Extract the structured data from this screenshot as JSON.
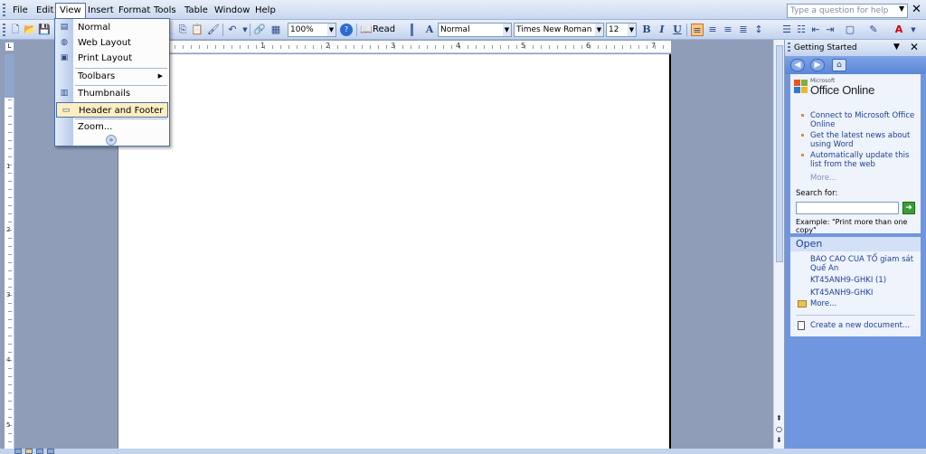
{
  "menu": {
    "items": [
      "File",
      "Edit",
      "View",
      "Insert",
      "Format",
      "Tools",
      "Table",
      "Window",
      "Help"
    ],
    "active": "View"
  },
  "help": {
    "placeholder": "Type a question for help"
  },
  "toolbar": {
    "zoom": "100%",
    "read_label": "Read",
    "style": "Normal",
    "font": "Times New Roman",
    "size": "12",
    "bold": "B",
    "italic": "I",
    "underline": "U"
  },
  "view_menu": {
    "items": [
      {
        "label": "Normal",
        "icon": "normal-view-icon"
      },
      {
        "label": "Web Layout",
        "icon": "web-layout-icon"
      },
      {
        "label": "Print Layout",
        "icon": "print-layout-icon"
      },
      {
        "label": "Toolbars",
        "submenu": true
      },
      {
        "label": "Thumbnails",
        "icon": "thumbnails-icon"
      },
      {
        "label": "Header and Footer",
        "icon": "header-footer-icon",
        "highlighted": true
      },
      {
        "label": "Zoom..."
      }
    ]
  },
  "ruler": {
    "h_numbers": [
      "1",
      "2",
      "3",
      "4",
      "5",
      "6",
      "7"
    ],
    "v_numbers": [
      "1",
      "2",
      "3",
      "4",
      "5"
    ]
  },
  "task_pane": {
    "title": "Getting Started",
    "logo_small": "Microsoft",
    "logo_main": "Office Online",
    "links": [
      "Connect to Microsoft Office Online",
      "Get the latest news about using Word",
      "Automatically update this list from the web"
    ],
    "more": "More...",
    "search_label": "Search for:",
    "example": "Example:  \"Print more than one copy\"",
    "open_heading": "Open",
    "recent_docs": [
      "BAO CAO CUA TỔ giam sát Quế An",
      "KT45ANH9-GHKI (1)",
      "KT45ANH9-GHKI"
    ],
    "open_more": "More...",
    "create_new": "Create a new document..."
  },
  "colors": {
    "accent": "#4b6ea8",
    "pane_bg": "#6f96df",
    "workspace": "#8f9db8",
    "highlight": "#ffeec2"
  }
}
